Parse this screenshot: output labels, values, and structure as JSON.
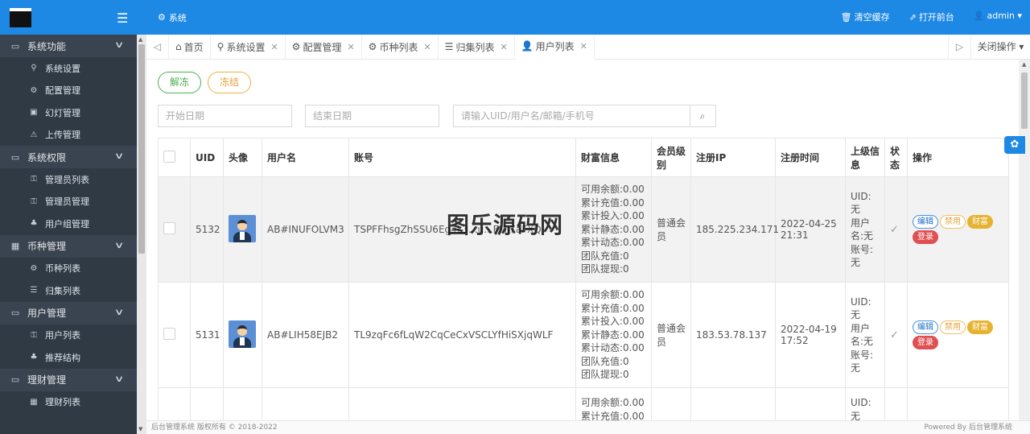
{
  "topbar": {
    "title": "系统",
    "actions": [
      {
        "icon": "trash-icon",
        "glyph": "🗑",
        "label": "清空缓存"
      },
      {
        "icon": "external-link-icon",
        "glyph": "⇗",
        "label": "打开前台"
      },
      {
        "icon": "user-icon",
        "glyph": "👤",
        "label": "admin ▾"
      }
    ]
  },
  "sidebar": {
    "groups": [
      {
        "label": "系统功能",
        "items": [
          "系统设置",
          "配置管理",
          "幻灯管理",
          "上传管理"
        ]
      },
      {
        "label": "系统权限",
        "items": [
          "管理员列表",
          "管理员管理",
          "用户组管理"
        ]
      },
      {
        "label": "币种管理",
        "items": [
          "币种列表",
          "归集列表"
        ]
      },
      {
        "label": "用户管理",
        "items": [
          "用户列表",
          "推荐结构"
        ]
      },
      {
        "label": "理财管理",
        "items": [
          "理财列表"
        ]
      }
    ]
  },
  "tabs": {
    "items": [
      {
        "label": "首页",
        "closable": false
      },
      {
        "label": "系统设置",
        "closable": true
      },
      {
        "label": "配置管理",
        "closable": true
      },
      {
        "label": "币种列表",
        "closable": true
      },
      {
        "label": "归集列表",
        "closable": true
      },
      {
        "label": "用户列表",
        "closable": true,
        "active": true
      }
    ],
    "close_ops": "关闭操作 ▾"
  },
  "toolbar": {
    "unfreeze": "解冻",
    "freeze": "冻结"
  },
  "filters": {
    "start_date": "开始日期",
    "end_date": "结束日期",
    "search_placeholder": "请输入UID/用户名/邮箱/手机号"
  },
  "table": {
    "headers": [
      "",
      "UID",
      "头像",
      "用户名",
      "账号",
      "财富信息",
      "会员级别",
      "注册IP",
      "注册时间",
      "上级信息",
      "状态",
      "操作"
    ],
    "rows": [
      {
        "uid": "5132",
        "username": "AB#INUFOLVM3",
        "account": "TSPFFhsgZhSSU6Eg4L3...u...FMj7aFXQ",
        "wealth": [
          "可用余额:0.00",
          "累计充值:0.00",
          "累计投入:0.00",
          "累计静态:0.00",
          "累计动态:0.00",
          "团队充值:0",
          "团队提现:0"
        ],
        "level": "普通会员",
        "ip": "185.225.234.171",
        "reg_time": "2022-04-25 21:31",
        "parent": [
          "UID:",
          "无",
          "用户",
          "名:无",
          "账号:",
          "无"
        ]
      },
      {
        "uid": "5131",
        "username": "AB#LIH58EJB2",
        "account": "TL9zqFc6fLqW2CqCeCxVSCLYfHiSXjqWLF",
        "wealth": [
          "可用余额:0.00",
          "累计充值:0.00",
          "累计投入:0.00",
          "累计静态:0.00",
          "累计动态:0.00",
          "团队充值:0",
          "团队提现:0"
        ],
        "level": "普通会员",
        "ip": "183.53.78.137",
        "reg_time": "2022-04-19 17:52",
        "parent": [
          "UID:",
          "无",
          "用户",
          "名:无",
          "账号:",
          "无"
        ]
      },
      {
        "wealth": [
          "可用余额:0.00",
          "累计充值:0.00"
        ],
        "parent": [
          "UID:",
          "无"
        ]
      }
    ],
    "ops": {
      "edit": "编辑",
      "disable": "禁用",
      "wealth": "财富",
      "login": "登录"
    }
  },
  "watermark": "图乐源码网",
  "footer": {
    "left": "后台管理系统 版权所有 © 2018-2022",
    "right": "Powered By 后台管理系统"
  }
}
